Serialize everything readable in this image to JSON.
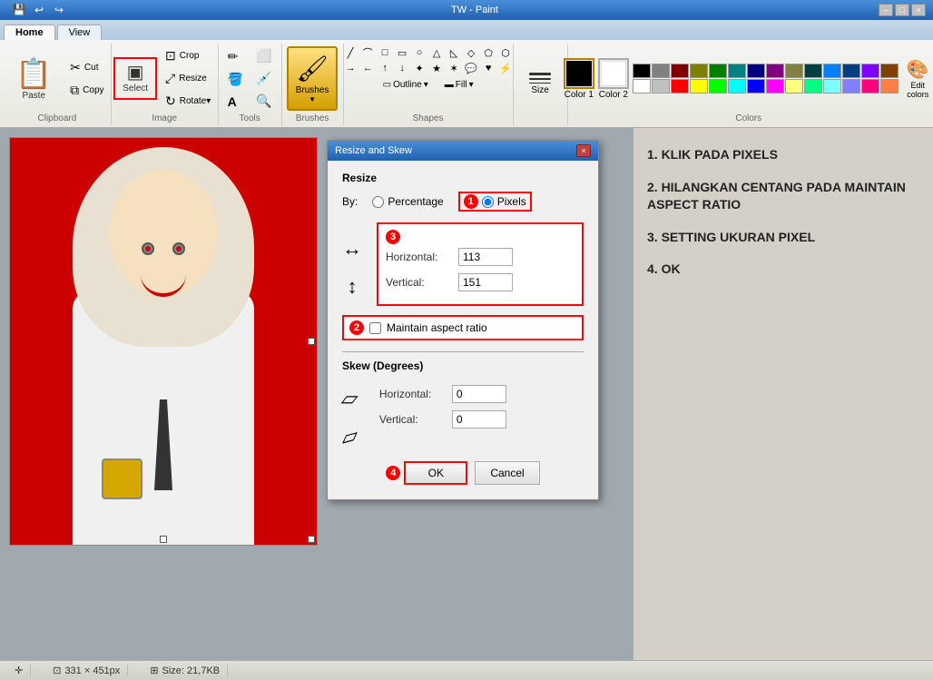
{
  "titlebar": {
    "title": "TW - Paint",
    "minimize": "–",
    "maximize": "□",
    "close": "×"
  },
  "ribbon": {
    "tabs": [
      {
        "id": "home",
        "label": "Home",
        "active": true
      },
      {
        "id": "view",
        "label": "View",
        "active": false
      }
    ],
    "groups": {
      "clipboard": {
        "label": "Clipboard",
        "paste": "Paste",
        "cut": "Cut",
        "copy": "Copy"
      },
      "image": {
        "label": "Image",
        "crop": "Crop",
        "resize": "Resize",
        "rotate": "Rotate▾",
        "select": "Select"
      },
      "tools": {
        "label": "Tools"
      },
      "brushes": {
        "label": "Brushes"
      },
      "shapes": {
        "label": "Shapes",
        "outline": "Outline",
        "fill": "Fill"
      },
      "colors": {
        "label": "Colors",
        "color1": "Color 1",
        "color2": "Color 2",
        "edit": "Edit colors"
      }
    }
  },
  "dialog": {
    "title": "Resize and Skew",
    "resize_label": "Resize",
    "by_label": "By:",
    "percentage_label": "Percentage",
    "pixels_label": "Pixels",
    "horizontal_label": "Horizontal:",
    "vertical_label": "Vertical:",
    "horizontal_value": "113",
    "vertical_value": "151",
    "maintain_aspect": "Maintain aspect ratio",
    "skew_label": "Skew (Degrees)",
    "skew_h_label": "Horizontal:",
    "skew_v_label": "Vertical:",
    "skew_h_value": "0",
    "skew_v_value": "0",
    "ok_label": "OK",
    "cancel_label": "Cancel",
    "badges": {
      "n1": "1",
      "n2": "2",
      "n3": "3",
      "n4": "4"
    }
  },
  "instructions": [
    {
      "id": "step1",
      "text": "1.  KLIK PADA PIXELS"
    },
    {
      "id": "step2",
      "text": "2.  HILANGKAN CENTANG PADA MAINTAIN ASPECT RATIO"
    },
    {
      "id": "step3",
      "text": "3.  SETTING UKURAN PIXEL"
    },
    {
      "id": "step4",
      "text": "4.  OK"
    }
  ],
  "statusbar": {
    "pointer_icon": "✛",
    "crop_icon": "⊡",
    "dimensions": "331 × 451px",
    "size_icon": "⊞",
    "filesize": "Size: 21,7KB"
  },
  "colors": {
    "swatches_row1": [
      "#000000",
      "#808080",
      "#800000",
      "#808000",
      "#008000",
      "#008080",
      "#000080",
      "#800080",
      "#808040",
      "#004040",
      "#0080FF",
      "#004080",
      "#8000FF",
      "#804000"
    ],
    "swatches_row2": [
      "#ffffff",
      "#c0c0c0",
      "#ff0000",
      "#ffff00",
      "#00ff00",
      "#00ffff",
      "#0000ff",
      "#ff00ff",
      "#ffff80",
      "#00ff80",
      "#80ffff",
      "#8080ff",
      "#ff0080",
      "#ff8040"
    ],
    "color1": "#000000",
    "color2": "#ffffff"
  },
  "qa_buttons": [
    "💾",
    "↩",
    "↪"
  ]
}
